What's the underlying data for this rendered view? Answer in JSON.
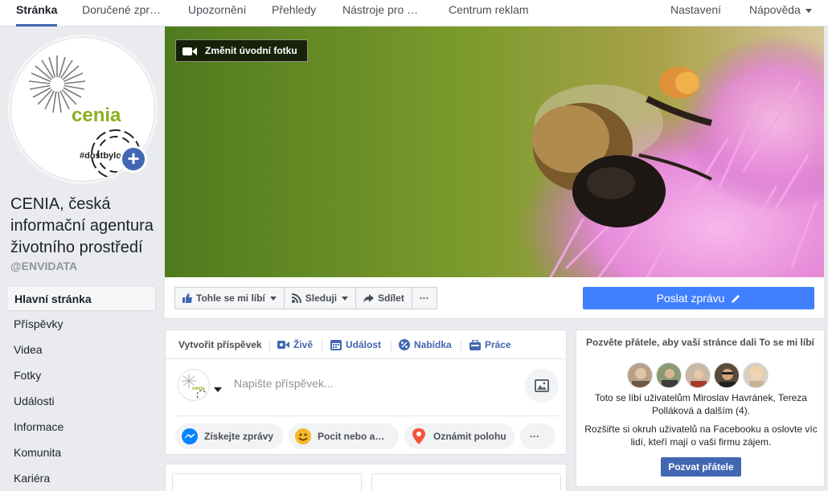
{
  "topnav": {
    "tabs": [
      {
        "label": "Stránka"
      },
      {
        "label": "Doručené zpr…"
      },
      {
        "label": "Upozornění"
      },
      {
        "label": "Přehledy"
      },
      {
        "label": "Nástroje pro …"
      },
      {
        "label": "Centrum reklam"
      }
    ],
    "settings": "Nastavení",
    "help": "Nápověda"
  },
  "page": {
    "logo_text": "cenia",
    "logo_hashtag": "#dostbylo",
    "name": "CENIA, česká informační agentura životního prostředí",
    "handle": "@ENVIDATA"
  },
  "leftnav": {
    "items": [
      {
        "label": "Hlavní stránka"
      },
      {
        "label": "Příspěvky"
      },
      {
        "label": "Videa"
      },
      {
        "label": "Fotky"
      },
      {
        "label": "Události"
      },
      {
        "label": "Informace"
      },
      {
        "label": "Komunita"
      },
      {
        "label": "Kariéra"
      }
    ]
  },
  "cover": {
    "change_label": "Změnit úvodní fotku"
  },
  "actions": {
    "like": "Tohle se mi líbí",
    "follow": "Sleduji",
    "share": "Sdílet",
    "more": "···",
    "send_message": "Poslat zprávu"
  },
  "composer": {
    "tabs": [
      {
        "label": "Vytvořit příspěvek"
      },
      {
        "label": "Živě"
      },
      {
        "label": "Událost"
      },
      {
        "label": "Nabídka"
      },
      {
        "label": "Práce"
      }
    ],
    "placeholder": "Napište příspěvek...",
    "avatar_text": "cenia",
    "pills": [
      {
        "label": "Získejte zprávy"
      },
      {
        "label": "Pocit nebo a…"
      },
      {
        "label": "Oznámit polohu"
      },
      {
        "label": "···"
      }
    ]
  },
  "invite": {
    "title": "Pozvěte přátele, aby vaší stránce dali To se mi líbí",
    "likes_text": "Toto se líbí uživatelům Miroslav Havránek, Tereza Polláková a dalším (4).",
    "expand_text": "Rozšiřte si okruh uživatelů na Facebooku a oslovte víc lidí, kteří mají o vaši firmu zájem.",
    "button": "Pozvat přátele"
  },
  "colors": {
    "brand_blue": "#4267b2",
    "message_blue": "#4080ff",
    "cenia_green": "#8cb021"
  }
}
